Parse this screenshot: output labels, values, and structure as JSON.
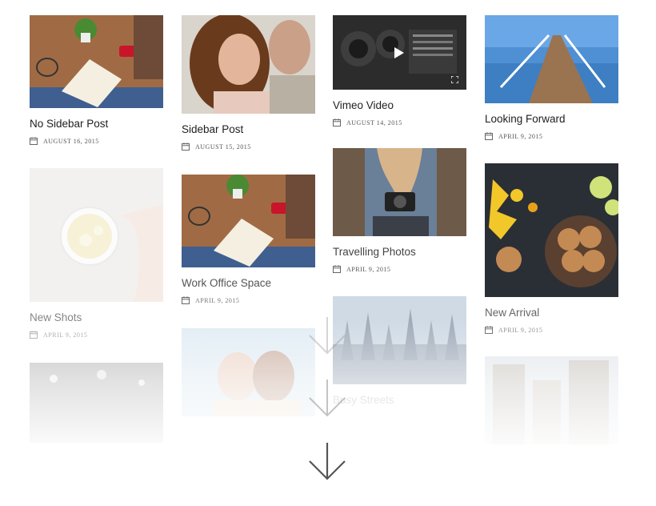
{
  "posts": [
    {
      "title": "No Sidebar Post",
      "date": "AUGUST 16, 2015",
      "image": "desk-notebook-photo"
    },
    {
      "title": "Sidebar Post",
      "date": "AUGUST 15, 2015",
      "image": "couple-portrait-photo"
    },
    {
      "title": "Vimeo Video",
      "date": "AUGUST 14, 2015",
      "image": "camera-lens-video-thumbnail"
    },
    {
      "title": "Looking Forward",
      "date": "APRIL 9, 2015",
      "image": "wooden-pier-photo"
    },
    {
      "title": "New Shots",
      "date": "APRIL 9, 2015",
      "image": "tea-cup-photo"
    },
    {
      "title": "Work Office Space",
      "date": "APRIL 9, 2015",
      "image": "desk-notebook-photo"
    },
    {
      "title": "Travelling Photos",
      "date": "APRIL 9, 2015",
      "image": "girl-camera-photo"
    },
    {
      "title": "New Arrival",
      "date": "APRIL 9, 2015",
      "image": "cookies-flowers-photo"
    },
    {
      "title": "Busy Streets",
      "date": "",
      "image": "forest-trees-photo"
    }
  ],
  "faded_thumbs": [
    "city-lights-photo",
    "couple-sunglasses-photo",
    "city-buildings-photo"
  ],
  "icons": {
    "date": "calendar-icon",
    "play": "play-icon",
    "fullscreen": "fullscreen-icon",
    "scroll": "arrow-down-icon"
  },
  "colors": {
    "title": "#1e1e1e",
    "meta": "#555555",
    "background": "#ffffff"
  }
}
